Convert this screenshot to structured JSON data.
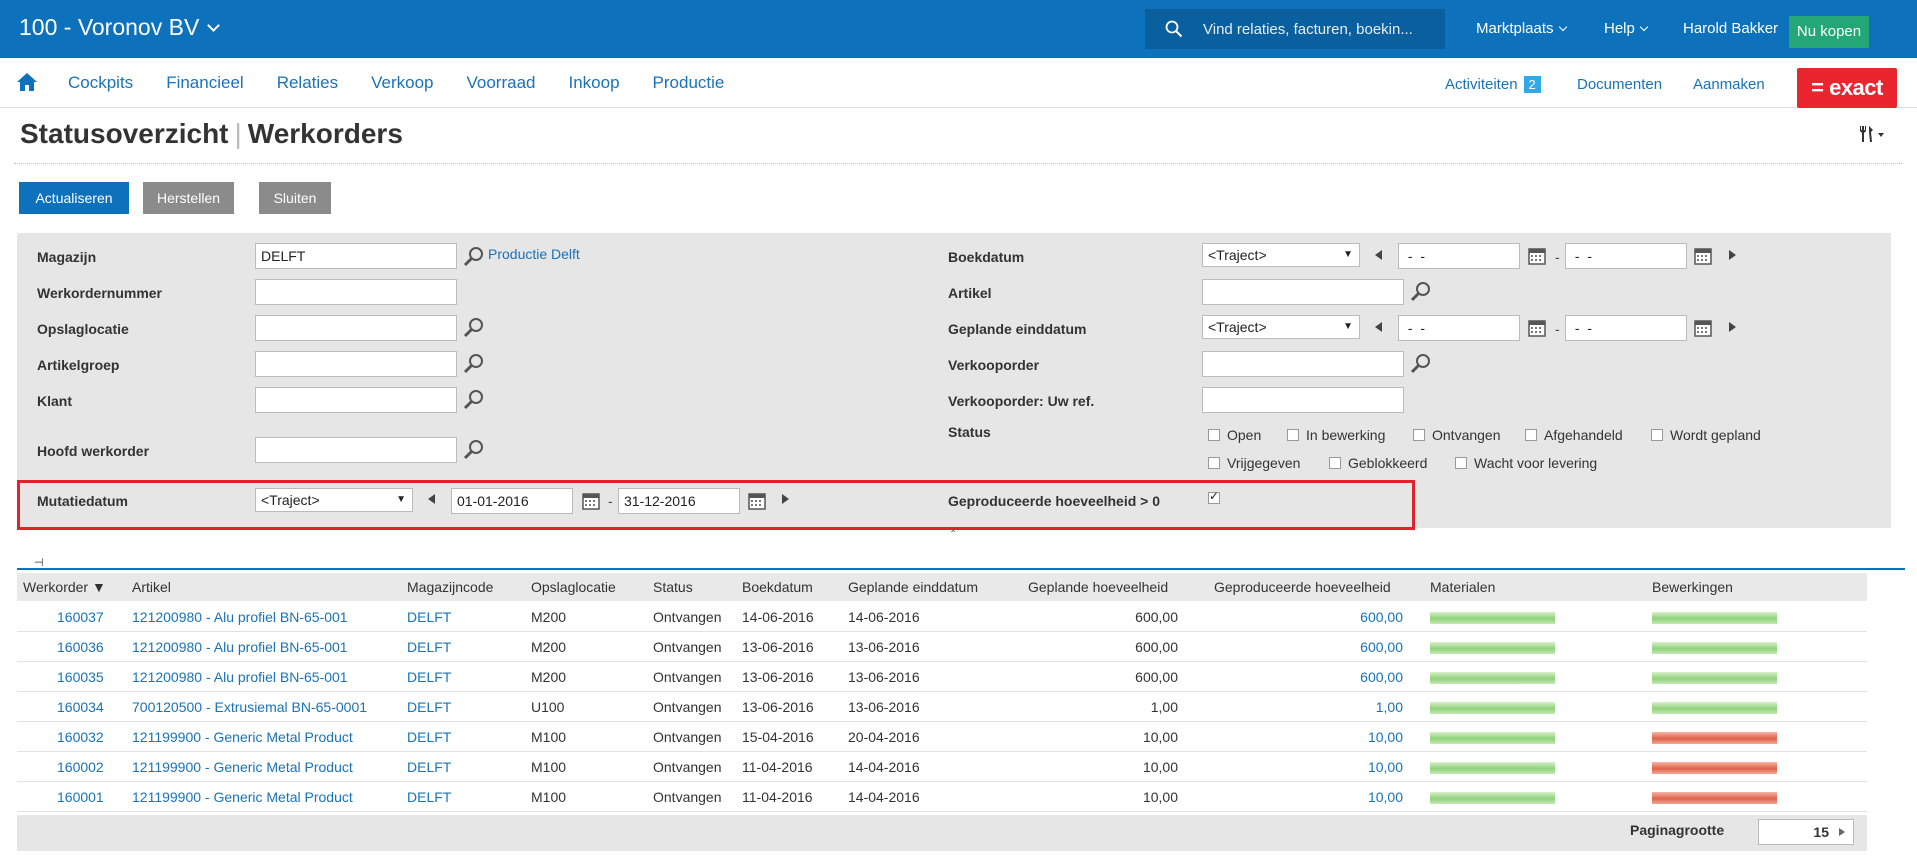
{
  "topbar": {
    "company": "100 - Voronov BV",
    "search_placeholder": "Vind relaties, facturen, boekin...",
    "marktplaats": "Marktplaats",
    "help": "Help",
    "user": "Harold Bakker",
    "buy": "Nu kopen"
  },
  "nav": {
    "items": [
      "Cockpits",
      "Financieel",
      "Relaties",
      "Verkoop",
      "Voorraad",
      "Inkoop",
      "Productie"
    ],
    "activiteiten": "Activiteiten",
    "activiteiten_count": "2",
    "documenten": "Documenten",
    "aanmaken": "Aanmaken",
    "logo": "= exact"
  },
  "page": {
    "title": "Statusoverzicht",
    "title_sep": "|",
    "subtitle": "Werkorders"
  },
  "buttons": {
    "actualiseren": "Actualiseren",
    "herstellen": "Herstellen",
    "sluiten": "Sluiten"
  },
  "filters": {
    "magazijn_label": "Magazijn",
    "magazijn_value": "DELFT",
    "magazijn_desc": "Productie Delft",
    "werkordernummer_label": "Werkordernummer",
    "opslaglocatie_label": "Opslaglocatie",
    "artikelgroep_label": "Artikelgroep",
    "klant_label": "Klant",
    "hoofdwerkorder_label": "Hoofd werkorder",
    "mutatiedatum_label": "Mutatiedatum",
    "mutatiedatum_mode": "<Traject>",
    "mutatiedatum_from": "01-01-2016",
    "mutatiedatum_to": "31-12-2016",
    "boekdatum_label": "Boekdatum",
    "boekdatum_mode": "<Traject>",
    "boekdatum_from": " -  - ",
    "boekdatum_to": " -  - ",
    "artikel_label": "Artikel",
    "geplande_einddatum_label": "Geplande einddatum",
    "geplande_einddatum_mode": "<Traject>",
    "geplande_einddatum_from": " -  - ",
    "geplande_einddatum_to": " -  - ",
    "verkooporder_label": "Verkooporder",
    "verkooporder_ref_label": "Verkooporder: Uw ref.",
    "status_label": "Status",
    "status_options": [
      "Open",
      "In bewerking",
      "Ontvangen",
      "Afgehandeld",
      "Wordt gepland",
      "Vrijgegeven",
      "Geblokkeerd",
      "Wacht voor levering"
    ],
    "geproduceerd_label": "Geproduceerde hoeveelheid > 0",
    "range_dash": "-"
  },
  "table": {
    "columns": [
      "Werkorder ▼",
      "Artikel",
      "Magazijncode",
      "Opslaglocatie",
      "Status",
      "Boekdatum",
      "Geplande einddatum",
      "Geplande hoeveelheid",
      "Geproduceerde hoeveelheid",
      "Materialen",
      "Bewerkingen"
    ],
    "rows": [
      {
        "werkorder": "160037",
        "artikel": "121200980 - Alu profiel BN-65-001",
        "magazijn": "DELFT",
        "locatie": "M200",
        "status": "Ontvangen",
        "boekdatum": "14-06-2016",
        "einddatum": "14-06-2016",
        "gepland": "600,00",
        "geproduceerd": "600,00",
        "materialen": "green",
        "bewerkingen": "green"
      },
      {
        "werkorder": "160036",
        "artikel": "121200980 - Alu profiel BN-65-001",
        "magazijn": "DELFT",
        "locatie": "M200",
        "status": "Ontvangen",
        "boekdatum": "13-06-2016",
        "einddatum": "13-06-2016",
        "gepland": "600,00",
        "geproduceerd": "600,00",
        "materialen": "green",
        "bewerkingen": "green"
      },
      {
        "werkorder": "160035",
        "artikel": "121200980 - Alu profiel BN-65-001",
        "magazijn": "DELFT",
        "locatie": "M200",
        "status": "Ontvangen",
        "boekdatum": "13-06-2016",
        "einddatum": "13-06-2016",
        "gepland": "600,00",
        "geproduceerd": "600,00",
        "materialen": "green",
        "bewerkingen": "green"
      },
      {
        "werkorder": "160034",
        "artikel": "700120500 - Extrusiemal BN-65-0001",
        "magazijn": "DELFT",
        "locatie": "U100",
        "status": "Ontvangen",
        "boekdatum": "13-06-2016",
        "einddatum": "13-06-2016",
        "gepland": "1,00",
        "geproduceerd": "1,00",
        "materialen": "green",
        "bewerkingen": "green"
      },
      {
        "werkorder": "160032",
        "artikel": "121199900 - Generic Metal Product",
        "magazijn": "DELFT",
        "locatie": "M100",
        "status": "Ontvangen",
        "boekdatum": "15-04-2016",
        "einddatum": "20-04-2016",
        "gepland": "10,00",
        "geproduceerd": "10,00",
        "materialen": "green",
        "bewerkingen": "red"
      },
      {
        "werkorder": "160002",
        "artikel": "121199900 - Generic Metal Product",
        "magazijn": "DELFT",
        "locatie": "M100",
        "status": "Ontvangen",
        "boekdatum": "11-04-2016",
        "einddatum": "14-04-2016",
        "gepland": "10,00",
        "geproduceerd": "10,00",
        "materialen": "green",
        "bewerkingen": "red"
      },
      {
        "werkorder": "160001",
        "artikel": "121199900 - Generic Metal Product",
        "magazijn": "DELFT",
        "locatie": "M100",
        "status": "Ontvangen",
        "boekdatum": "11-04-2016",
        "einddatum": "14-04-2016",
        "gepland": "10,00",
        "geproduceerd": "10,00",
        "materialen": "green",
        "bewerkingen": "red"
      }
    ]
  },
  "footer": {
    "pagesize_label": "Paginagrootte",
    "pagesize_value": "15"
  },
  "colors": {
    "brand": "#0d71bb",
    "buy_green": "#24a776",
    "logo_red": "#e9262d",
    "highlight": "#e0222d",
    "bar_green": "#8fd27a",
    "bar_red": "#e0624a"
  }
}
